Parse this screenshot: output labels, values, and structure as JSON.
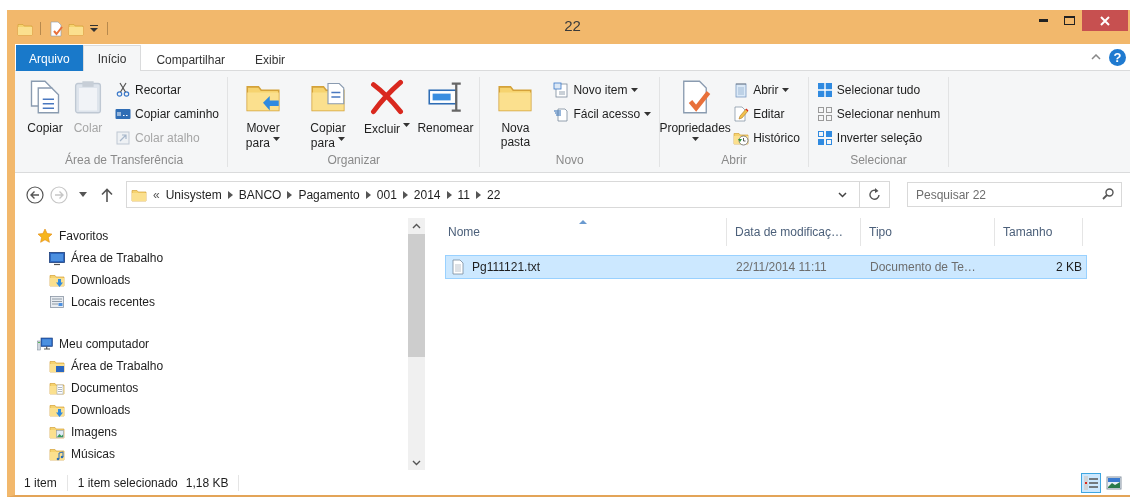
{
  "window": {
    "title": "22"
  },
  "tabs": [
    {
      "label": "Arquivo",
      "kind": "file",
      "selected": false
    },
    {
      "label": "Início",
      "kind": "tab",
      "selected": true
    },
    {
      "label": "Compartilhar",
      "kind": "tab",
      "selected": false
    },
    {
      "label": "Exibir",
      "kind": "tab",
      "selected": false
    }
  ],
  "help": "?",
  "ribbon": {
    "groups": [
      {
        "label": "Área de Transferência",
        "buttons": [
          {
            "kind": "large",
            "label": "Copiar",
            "disabled": false,
            "dropdown": false
          },
          {
            "kind": "large",
            "label": "Colar",
            "disabled": true,
            "dropdown": false
          },
          {
            "kind": "small",
            "label": "Recortar",
            "disabled": false,
            "dropdown": false
          },
          {
            "kind": "small",
            "label": "Copiar caminho",
            "disabled": false,
            "dropdown": false
          },
          {
            "kind": "small",
            "label": "Colar atalho",
            "disabled": true,
            "dropdown": false
          }
        ]
      },
      {
        "label": "Organizar",
        "buttons": [
          {
            "kind": "large",
            "label": "Mover para",
            "disabled": false,
            "dropdown": true
          },
          {
            "kind": "large",
            "label": "Copiar para",
            "disabled": false,
            "dropdown": true
          },
          {
            "kind": "large",
            "label": "Excluir",
            "disabled": false,
            "dropdown": true
          },
          {
            "kind": "large",
            "label": "Renomear",
            "disabled": false,
            "dropdown": false
          }
        ]
      },
      {
        "label": "Novo",
        "buttons": [
          {
            "kind": "large",
            "label": "Nova pasta",
            "disabled": false,
            "dropdown": false
          },
          {
            "kind": "small",
            "label": "Novo item",
            "disabled": false,
            "dropdown": true
          },
          {
            "kind": "small",
            "label": "Fácil acesso",
            "disabled": false,
            "dropdown": true
          }
        ]
      },
      {
        "label": "Abrir",
        "buttons": [
          {
            "kind": "large",
            "label": "Propriedades",
            "disabled": false,
            "dropdown": true
          },
          {
            "kind": "small",
            "label": "Abrir",
            "disabled": false,
            "dropdown": true
          },
          {
            "kind": "small",
            "label": "Editar",
            "disabled": false,
            "dropdown": false
          },
          {
            "kind": "small",
            "label": "Histórico",
            "disabled": false,
            "dropdown": false
          }
        ]
      },
      {
        "label": "Selecionar",
        "buttons": [
          {
            "kind": "small",
            "label": "Selecionar tudo",
            "disabled": false,
            "dropdown": false
          },
          {
            "kind": "small",
            "label": "Selecionar nenhum",
            "disabled": false,
            "dropdown": false
          },
          {
            "kind": "small",
            "label": "Inverter seleção",
            "disabled": false,
            "dropdown": false
          }
        ]
      }
    ]
  },
  "address": {
    "nav_buttons": [
      {
        "kind": "back",
        "disabled": false
      },
      {
        "kind": "forward",
        "disabled": true
      },
      {
        "kind": "recent",
        "disabled": false
      },
      {
        "kind": "up",
        "disabled": false
      }
    ],
    "overflow": "«",
    "segments": [
      "Unisystem",
      "BANCO",
      "Pagamento",
      "001",
      "2014",
      "11",
      "22"
    ],
    "search": {
      "placeholder": "Pesquisar 22"
    }
  },
  "navigation": [
    {
      "label": "Favoritos",
      "children": [
        {
          "label": "Área de Trabalho"
        },
        {
          "label": "Downloads"
        },
        {
          "label": "Locais recentes"
        }
      ]
    },
    {
      "label": "Meu computador",
      "children": [
        {
          "label": "Área de Trabalho"
        },
        {
          "label": "Documentos"
        },
        {
          "label": "Downloads"
        },
        {
          "label": "Imagens"
        },
        {
          "label": "Músicas"
        }
      ]
    }
  ],
  "file_list": {
    "columns": [
      {
        "label": "Nome",
        "sorted": true
      },
      {
        "label": "Data de modificaç…",
        "sorted": false
      },
      {
        "label": "Tipo",
        "sorted": false
      },
      {
        "label": "Tamanho",
        "sorted": false
      }
    ],
    "rows": [
      {
        "selected": true,
        "cells": [
          "Pg111121.txt",
          "22/11/2014 11:11",
          "Documento de Te…",
          "2 KB"
        ]
      }
    ]
  },
  "status_bar": {
    "item_count": "1 item",
    "selection": "1 item selecionado",
    "selection_size": "1,18 KB",
    "views": [
      {
        "kind": "details",
        "selected": true
      },
      {
        "kind": "large-icons",
        "selected": false
      }
    ]
  }
}
